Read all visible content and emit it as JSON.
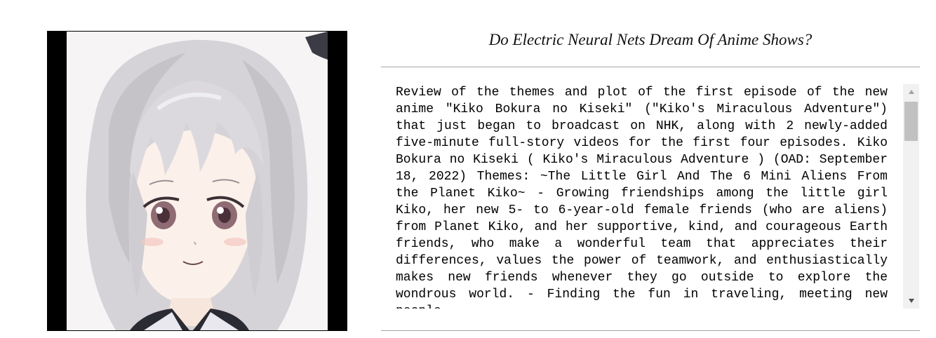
{
  "page": {
    "title": "Do Electric Neural Nets Dream Of Anime Shows?"
  },
  "image": {
    "kind": "anime-girl-portrait",
    "hair_color": "#d9d6da",
    "background": "#000000"
  },
  "review": {
    "text": "Review of the themes and plot of the first episode of the new anime \"Kiko Bokura no Kiseki\" (\"Kiko's Miraculous Adventure\") that just began to broadcast on NHK, along with 2 newly-added five-minute full-story videos for the first four episodes. Kiko Bokura no Kiseki ( Kiko's Miraculous Adventure ) (OAD: September 18, 2022) Themes: ~The Little Girl And The 6 Mini Aliens From the Planet Kiko~ - Growing friendships among the little girl Kiko, her new 5- to 6-year-old female friends (who are aliens) from Planet Kiko, and her supportive, kind, and courageous Earth friends, who make a wonderful team that appreciates their differences, values the power of teamwork, and enthusiastically makes new friends whenever they go outside to explore the wondrous world. - Finding the fun in traveling, meeting new people"
  },
  "scrollbar": {
    "up_icon": "triangle-up-icon",
    "down_icon": "triangle-down-icon",
    "scroll_fraction": 0.0
  }
}
